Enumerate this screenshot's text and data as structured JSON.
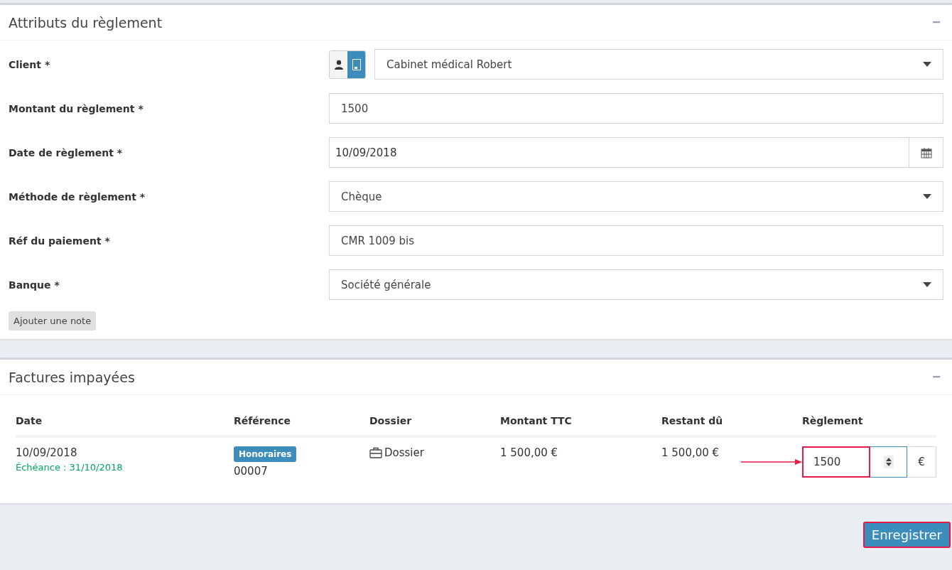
{
  "payment_panel": {
    "title": "Attributs du règlement",
    "collapse_icon": "−",
    "fields": [
      {
        "kind": "client",
        "label": "Client *",
        "value": "Cabinet médical Robert",
        "client_types": [
          {
            "kind": "person",
            "selected": false
          },
          {
            "kind": "company",
            "selected": true
          }
        ]
      },
      {
        "kind": "input",
        "label": "Montant du règlement *",
        "value": "1500"
      },
      {
        "kind": "date",
        "label": "Date de règlement *",
        "value": "10/09/2018"
      },
      {
        "kind": "select",
        "label": "Méthode de règlement *",
        "value": "Chèque"
      },
      {
        "kind": "input",
        "label": "Réf du paiement *",
        "value": "CMR 1009 bis"
      },
      {
        "kind": "select",
        "label": "Banque *",
        "value": "Société générale"
      }
    ],
    "note_button": "Ajouter une note"
  },
  "invoices_panel": {
    "title": "Factures impayées",
    "collapse_icon": "−",
    "columns": [
      "Date",
      "Référence",
      "Dossier",
      "Montant TTC",
      "Restant dû",
      "Règlement"
    ],
    "rows": [
      {
        "date": "10/09/2018",
        "due": "Échéance : 31/10/2018",
        "tag": "Honoraires",
        "reference": "00007",
        "folder": "Dossier",
        "amount": "1 500,00 €",
        "remaining": "1 500,00 €",
        "payment": "1500",
        "currency": "€",
        "highlighted": true
      }
    ]
  },
  "save_button": {
    "label": "Enregistrer",
    "highlighted": true
  }
}
